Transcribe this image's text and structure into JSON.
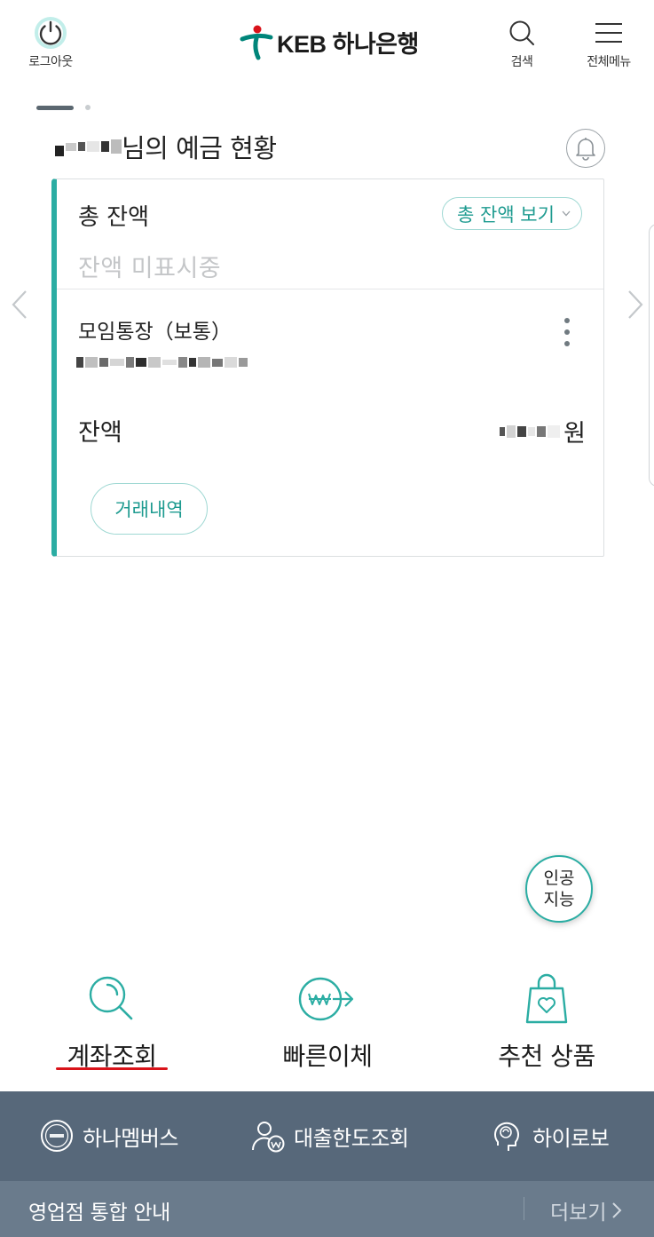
{
  "header": {
    "logout_label": "로그아웃",
    "logo_text": "KEB 하나은행",
    "search_label": "검색",
    "menu_label": "전체메뉴"
  },
  "greeting": {
    "suffix": "님의 예금 현황"
  },
  "account_card": {
    "total_label": "총 잔액",
    "total_toggle_label": "총 잔액 보기",
    "total_hidden_text": "잔액 미표시중",
    "account_name": "모임통장（보통）",
    "balance_label": "잔액",
    "balance_unit": "원",
    "history_button": "거래내역"
  },
  "ai_button": {
    "line1": "인공",
    "line2": "지능"
  },
  "quick_menu": [
    {
      "label": "계좌조회",
      "icon": "magnifier-icon",
      "selected": true
    },
    {
      "label": "빠른이체",
      "icon": "won-transfer-icon",
      "selected": false
    },
    {
      "label": "추천 상품",
      "icon": "shopping-bag-heart-icon",
      "selected": false
    }
  ],
  "bottom_menu": [
    {
      "label": "하나멤버스",
      "icon": "hana-coin-icon"
    },
    {
      "label": "대출한도조회",
      "icon": "person-won-icon"
    },
    {
      "label": "하이로보",
      "icon": "robo-head-icon"
    }
  ],
  "branch_bar": {
    "label": "영업점 통합 안내",
    "more_label": "더보기"
  },
  "colors": {
    "accent": "#2bada3",
    "accent_text": "#1e9b90",
    "brand_red": "#d9131a",
    "bottom_bar": "#57687a",
    "branch_bar": "#6a7b8c"
  }
}
